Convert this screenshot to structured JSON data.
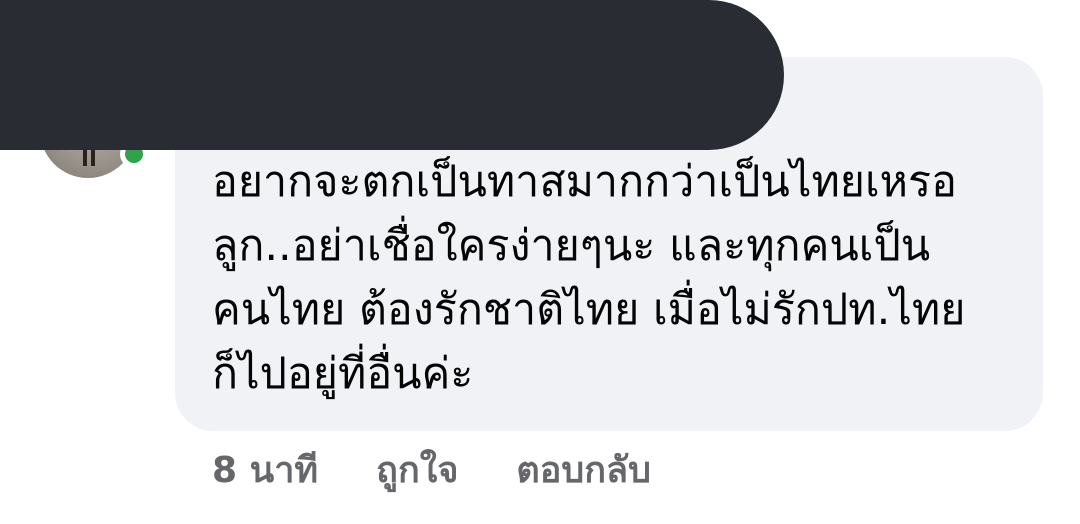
{
  "comment": {
    "author_name": "",
    "text_lines": [
      "อยากจะตกเป็นทาสมากกว่าเป็นไทยเหรอ",
      "ลูก..อย่าเชื่อใครง่ายๆนะ และทุกคนเป็น",
      "คนไทย ต้องรักชาติไทย เมื่อไม่รักปท.ไทย",
      "ก็ไปอยู่ที่อื่นค่ะ"
    ],
    "timestamp": "8 นาที",
    "like_label": "ถูกใจ",
    "reply_label": "ตอบกลับ",
    "online_status_color": "#31a24c",
    "bubble_color": "#f0f2f5",
    "redaction_color": "#292d33"
  }
}
